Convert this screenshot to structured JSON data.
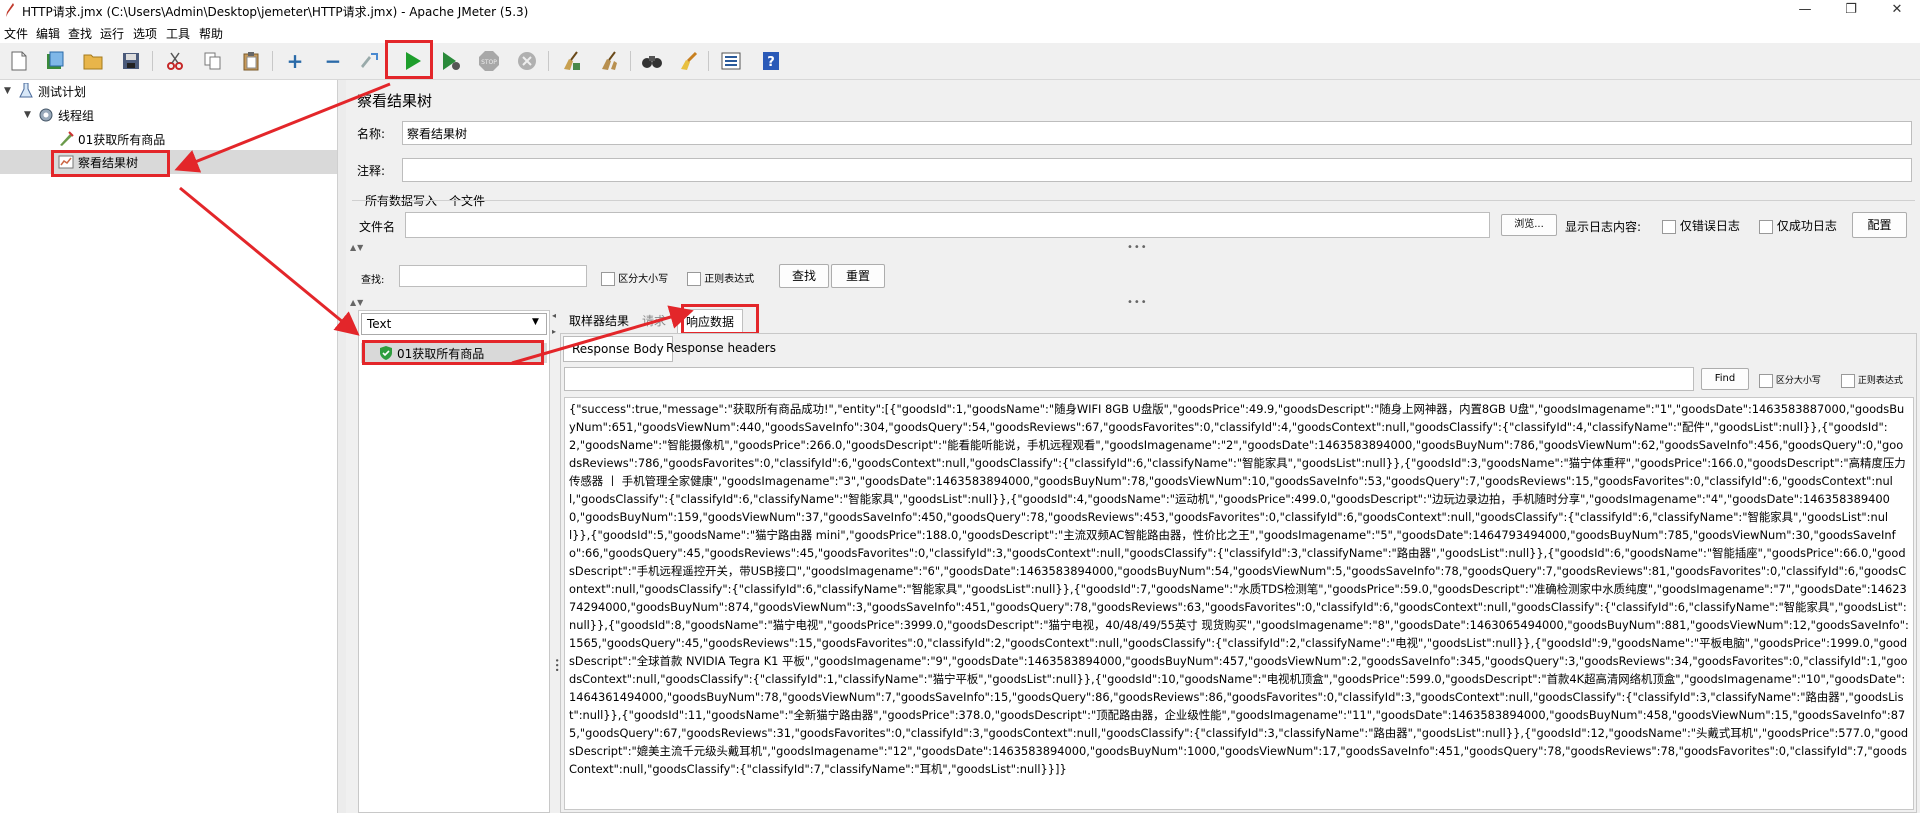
{
  "window": {
    "title": "HTTP请求.jmx (C:\\Users\\Admin\\Desktop\\jemeter\\HTTP请求.jmx) - Apache JMeter (5.3)",
    "minimize": "—",
    "maximize": "❐",
    "close": "✕"
  },
  "menu": [
    "文件",
    "编辑",
    "查找",
    "运行",
    "选项",
    "工具",
    "帮助"
  ],
  "toolbar": {
    "icons": [
      "new-icon",
      "templates-icon",
      "open-icon",
      "save-icon",
      "cut-icon",
      "copy-icon",
      "paste-icon",
      "expand-icon",
      "collapse-icon",
      "toggle-icon",
      "start-icon",
      "start-no-pause-icon",
      "stop-icon",
      "shutdown-icon",
      "clear-icon",
      "clear-all-icon",
      "search-icon",
      "reset-search-icon",
      "function-helper-icon",
      "help-icon"
    ]
  },
  "tree": {
    "items": [
      {
        "label": "测试计划",
        "icon": "test-plan-icon"
      },
      {
        "label": "线程组",
        "icon": "thread-group-icon"
      },
      {
        "label": "01获取所有商品",
        "icon": "http-sampler-icon"
      },
      {
        "label": "察看结果树",
        "icon": "results-tree-icon"
      }
    ]
  },
  "panel": {
    "heading": "察看结果树",
    "name_label": "名称:",
    "name_value": "察看结果树",
    "comment_label": "注释:",
    "comment_value": "",
    "file_section": "所有数据写入一个文件",
    "filename_label": "文件名",
    "filename_value": "",
    "browse_button": "浏览...",
    "log_label": "显示日志内容:",
    "errors_only": "仅错误日志",
    "success_only": "仅成功日志",
    "configure_button": "配置",
    "search_label": "查找:",
    "search_value": "",
    "case_sensitive": "区分大小写",
    "regex": "正则表达式",
    "find_button": "查找",
    "reset_button": "重置",
    "divider_dots": "•••",
    "collapse_arrows": "▲▼"
  },
  "results": {
    "renderer": "Text",
    "samples": [
      {
        "label": "01获取所有商品",
        "status": "success"
      }
    ],
    "tabs": [
      "取样器结果",
      "请求",
      "响应数据"
    ],
    "active_tab": "响应数据",
    "subtabs": [
      "Response Body",
      "Response headers"
    ],
    "find_value": "",
    "find_button": "Find",
    "find_case": "区分大小写",
    "find_regex": "正则表达式",
    "response_body": "{\"success\":true,\"message\":\"获取所有商品成功!\",\"entity\":[{\"goodsId\":1,\"goodsName\":\"随身WIFI 8GB U盘版\",\"goodsPrice\":49.9,\"goodsDescript\":\"随身上网神器，内置8GB U盘\",\"goodsImagename\":\"1\",\"goodsDate\":1463583887000,\"goodsBuyNum\":651,\"goodsViewNum\":440,\"goodsSaveInfo\":304,\"goodsQuery\":54,\"goodsReviews\":67,\"goodsFavorites\":0,\"classifyId\":4,\"goodsContext\":null,\"goodsClassify\":{\"classifyId\":4,\"classifyName\":\"配件\",\"goodsList\":null}},{\"goodsId\":2,\"goodsName\":\"智能摄像机\",\"goodsPrice\":266.0,\"goodsDescript\":\"能看能听能说，手机远程观看\",\"goodsImagename\":\"2\",\"goodsDate\":1463583894000,\"goodsBuyNum\":786,\"goodsViewNum\":62,\"goodsSaveInfo\":456,\"goodsQuery\":0,\"goodsReviews\":786,\"goodsFavorites\":0,\"classifyId\":6,\"goodsContext\":null,\"goodsClassify\":{\"classifyId\":6,\"classifyName\":\"智能家具\",\"goodsList\":null}},{\"goodsId\":3,\"goodsName\":\"猫宁体重秤\",\"goodsPrice\":166.0,\"goodsDescript\":\"高精度压力传感器 丨 手机管理全家健康\",\"goodsImagename\":\"3\",\"goodsDate\":1463583894000,\"goodsBuyNum\":78,\"goodsViewNum\":10,\"goodsSaveInfo\":53,\"goodsQuery\":7,\"goodsReviews\":15,\"goodsFavorites\":0,\"classifyId\":6,\"goodsContext\":null,\"goodsClassify\":{\"classifyId\":6,\"classifyName\":\"智能家具\",\"goodsList\":null}},{\"goodsId\":4,\"goodsName\":\"运动机\",\"goodsPrice\":499.0,\"goodsDescript\":\"边玩边录边拍，手机随时分享\",\"goodsImagename\":\"4\",\"goodsDate\":1463583894000,\"goodsBuyNum\":159,\"goodsViewNum\":37,\"goodsSaveInfo\":450,\"goodsQuery\":78,\"goodsReviews\":453,\"goodsFavorites\":0,\"classifyId\":6,\"goodsContext\":null,\"goodsClassify\":{\"classifyId\":6,\"classifyName\":\"智能家具\",\"goodsList\":null}},{\"goodsId\":5,\"goodsName\":\"猫宁路由器 mini\",\"goodsPrice\":188.0,\"goodsDescript\":\"主流双频AC智能路由器，性价比之王\",\"goodsImagename\":\"5\",\"goodsDate\":1464793494000,\"goodsBuyNum\":785,\"goodsViewNum\":30,\"goodsSaveInfo\":66,\"goodsQuery\":45,\"goodsReviews\":45,\"goodsFavorites\":0,\"classifyId\":3,\"goodsContext\":null,\"goodsClassify\":{\"classifyId\":3,\"classifyName\":\"路由器\",\"goodsList\":null}},{\"goodsId\":6,\"goodsName\":\"智能插座\",\"goodsPrice\":66.0,\"goodsDescript\":\"手机远程遥控开关，带USB接口\",\"goodsImagename\":\"6\",\"goodsDate\":1463583894000,\"goodsBuyNum\":54,\"goodsViewNum\":5,\"goodsSaveInfo\":78,\"goodsQuery\":7,\"goodsReviews\":81,\"goodsFavorites\":0,\"classifyId\":6,\"goodsContext\":null,\"goodsClassify\":{\"classifyId\":6,\"classifyName\":\"智能家具\",\"goodsList\":null}},{\"goodsId\":7,\"goodsName\":\"水质TDS检测笔\",\"goodsPrice\":59.0,\"goodsDescript\":\"准确检测家中水质纯度\",\"goodsImagename\":\"7\",\"goodsDate\":1462374294000,\"goodsBuyNum\":874,\"goodsViewNum\":3,\"goodsSaveInfo\":451,\"goodsQuery\":78,\"goodsReviews\":63,\"goodsFavorites\":0,\"classifyId\":6,\"goodsContext\":null,\"goodsClassify\":{\"classifyId\":6,\"classifyName\":\"智能家具\",\"goodsList\":null}},{\"goodsId\":8,\"goodsName\":\"猫宁电视\",\"goodsPrice\":3999.0,\"goodsDescript\":\"猫宁电视，40/48/49/55英寸 现货购买\",\"goodsImagename\":\"8\",\"goodsDate\":1463065494000,\"goodsBuyNum\":881,\"goodsViewNum\":12,\"goodsSaveInfo\":1565,\"goodsQuery\":45,\"goodsReviews\":15,\"goodsFavorites\":0,\"classifyId\":2,\"goodsContext\":null,\"goodsClassify\":{\"classifyId\":2,\"classifyName\":\"电视\",\"goodsList\":null}},{\"goodsId\":9,\"goodsName\":\"平板电脑\",\"goodsPrice\":1999.0,\"goodsDescript\":\"全球首款 NVIDIA Tegra K1 平板\",\"goodsImagename\":\"9\",\"goodsDate\":1463583894000,\"goodsBuyNum\":457,\"goodsViewNum\":2,\"goodsSaveInfo\":345,\"goodsQuery\":3,\"goodsReviews\":34,\"goodsFavorites\":0,\"classifyId\":1,\"goodsContext\":null,\"goodsClassify\":{\"classifyId\":1,\"classifyName\":\"猫宁平板\",\"goodsList\":null}},{\"goodsId\":10,\"goodsName\":\"电视机顶盒\",\"goodsPrice\":599.0,\"goodsDescript\":\"首款4K超高清网络机顶盒\",\"goodsImagename\":\"10\",\"goodsDate\":1464361494000,\"goodsBuyNum\":78,\"goodsViewNum\":7,\"goodsSaveInfo\":15,\"goodsQuery\":86,\"goodsReviews\":86,\"goodsFavorites\":0,\"classifyId\":3,\"goodsContext\":null,\"goodsClassify\":{\"classifyId\":3,\"classifyName\":\"路由器\",\"goodsList\":null}},{\"goodsId\":11,\"goodsName\":\"全新猫宁路由器\",\"goodsPrice\":378.0,\"goodsDescript\":\"顶配路由器，企业级性能\",\"goodsImagename\":\"11\",\"goodsDate\":1463583894000,\"goodsBuyNum\":458,\"goodsViewNum\":15,\"goodsSaveInfo\":875,\"goodsQuery\":67,\"goodsReviews\":31,\"goodsFavorites\":0,\"classifyId\":3,\"goodsContext\":null,\"goodsClassify\":{\"classifyId\":3,\"classifyName\":\"路由器\",\"goodsList\":null}},{\"goodsId\":12,\"goodsName\":\"头戴式耳机\",\"goodsPrice\":577.0,\"goodsDescript\":\"媲美主流千元级头戴耳机\",\"goodsImagename\":\"12\",\"goodsDate\":1463583894000,\"goodsBuyNum\":1000,\"goodsViewNum\":17,\"goodsSaveInfo\":451,\"goodsQuery\":78,\"goodsReviews\":78,\"goodsFavorites\":0,\"classifyId\":7,\"goodsContext\":null,\"goodsClassify\":{\"classifyId\":7,\"classifyName\":\"耳机\",\"goodsList\":null}}]}"
  },
  "colors": {
    "highlight": "#e3262a",
    "play_green": "#1e9e2c",
    "selected_row": "#d9d9d9"
  }
}
